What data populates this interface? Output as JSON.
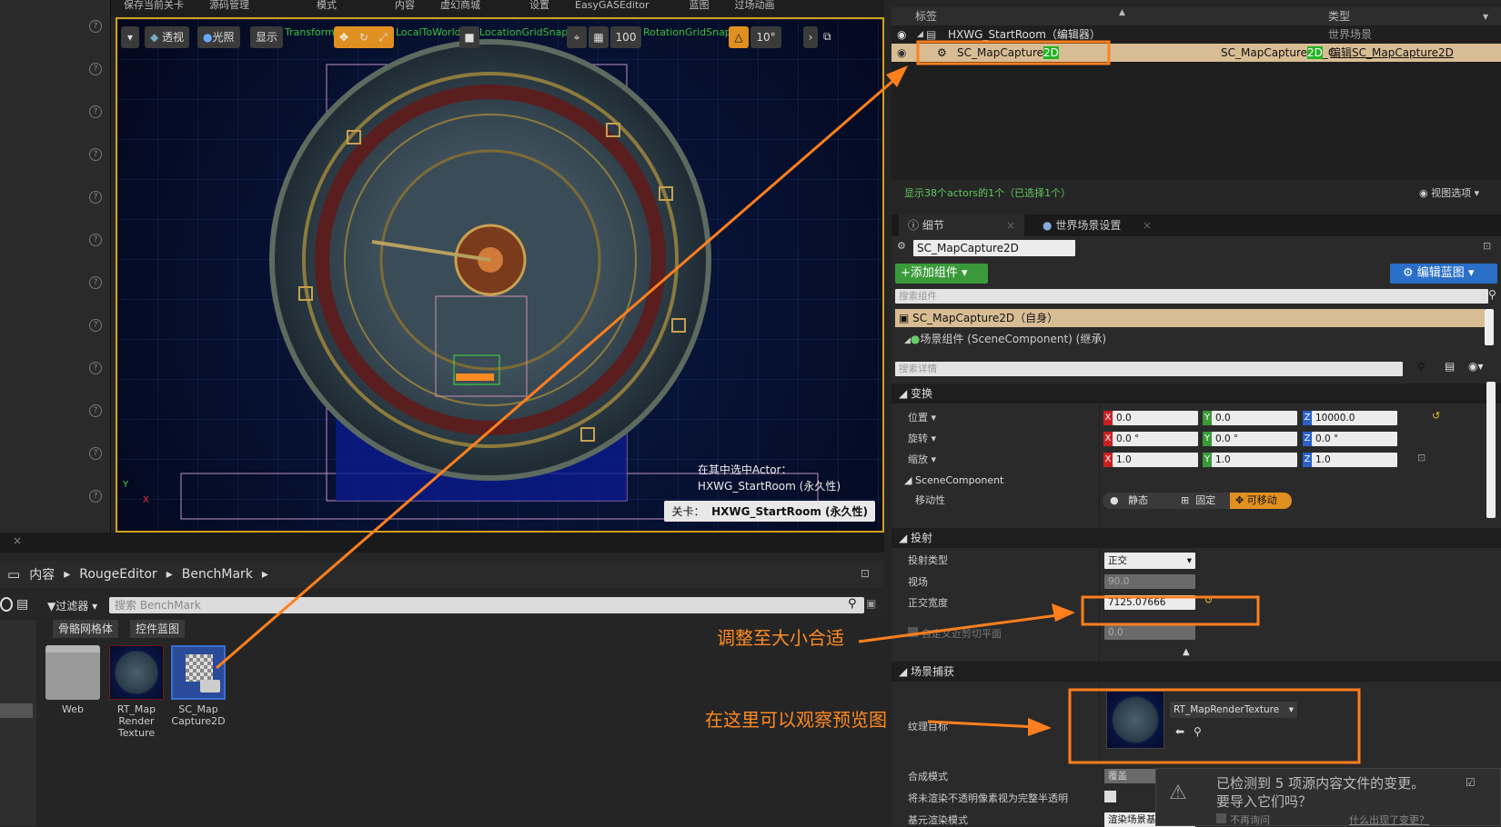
{
  "top_menu": [
    "保存当前关卡",
    "源码管理",
    "模式",
    "内容",
    "虚幻商城",
    "设置",
    "EasyGASEditor",
    "蓝图",
    "过场动画"
  ],
  "viewport": {
    "tools": {
      "perspective": "透视",
      "lit": "光照",
      "show": "显示",
      "grid_size": "100",
      "angle_snap": "10°"
    },
    "green_labels": [
      "Transform",
      "LocalToWorld",
      "LocationGridSnap",
      "RotationGridSnap"
    ],
    "selected_actor_label": "在其中选中Actor：",
    "selected_actor_name": "HXWG_StartRoom (永久性)",
    "level_label": "关卡：",
    "level_name": "HXWG_StartRoom (永久性)"
  },
  "content_browser": {
    "breadcrumb": [
      "内容",
      "RougeEditor",
      "BenchMark"
    ],
    "filter_label": "过滤器",
    "search_placeholder": "搜索 BenchMark",
    "filter_chips": [
      "骨骼网格体",
      "控件蓝图"
    ],
    "assets": [
      {
        "name": "Web",
        "type": "folder-icon"
      },
      {
        "name": "RT_Map Render Texture",
        "type": "render-texture-thumb"
      },
      {
        "name": "SC_Map Capture2D",
        "type": "scene-capture-thumb"
      }
    ]
  },
  "outliner": {
    "col_label": "标签",
    "col_type": "类型",
    "rows": [
      {
        "label": "HXWG_StartRoom（编辑器）",
        "type": "世界场景"
      },
      {
        "label_pre": "SC_MapCapture",
        "label_hl": "2D",
        "type_pre": "SC_MapCapture",
        "type_hl": "2D",
        "type_post": "_C",
        "action": "编辑SC_MapCapture2D"
      }
    ],
    "status": "显示38个actors的1个（已选择1个）",
    "view_options": "视图选项"
  },
  "details": {
    "tabs": [
      "细节",
      "世界场景设置"
    ],
    "actor_name": "SC_MapCapture2D",
    "add_component": "+添加组件",
    "edit_blueprint": "编辑蓝图",
    "search_components_placeholder": "搜索组件",
    "self_component": "SC_MapCapture2D（自身）",
    "scene_component": "场景组件 (SceneComponent) (继承)",
    "search_details_placeholder": "搜索详情",
    "sections": {
      "transform": "变换",
      "scene_component": "SceneComponent",
      "projection": "投射",
      "scene_capture": "场景捕获"
    },
    "transform": {
      "location_label": "位置",
      "rotation_label": "旋转",
      "scale_label": "缩放",
      "location": [
        "0.0",
        "0.0",
        "10000.0"
      ],
      "rotation": [
        "0.0 °",
        "0.0 °",
        "0.0 °"
      ],
      "scale": [
        "1.0",
        "1.0",
        "1.0"
      ]
    },
    "mobility": {
      "label": "移动性",
      "options": [
        "静态",
        "固定",
        "可移动"
      ],
      "selected": "可移动"
    },
    "projection": {
      "type_label": "投射类型",
      "type_value": "正交",
      "fov_label": "视场",
      "fov_value": "90.0",
      "ortho_width_label": "正交宽度",
      "ortho_width_value": "7125.07666",
      "custom_clip_label": "自定义近剪切平面",
      "custom_clip_value": "0.0"
    },
    "capture": {
      "texture_target_label": "纹理目标",
      "texture_target_value": "RT_MapRenderTexture",
      "composite_label": "合成模式",
      "composite_value": "覆盖",
      "opaque_label": "将未渲染不透明像素视为完整半透明",
      "primitive_label": "基元渲染模式",
      "primitive_value": "渲染场景基"
    }
  },
  "notification": {
    "line1": "已检测到 5 项源内容文件的变更。",
    "line2": "要导入它们吗？",
    "dont_ask": "不再询问",
    "why": "什么出现了变更？"
  },
  "annotations": {
    "adjust": "调整至大小合适",
    "preview": "在这里可以观察预览图"
  },
  "colors": {
    "accent_orange": "#ff7f1e",
    "highlight_green": "#22b422",
    "selection_bg": "#d8bd94"
  }
}
